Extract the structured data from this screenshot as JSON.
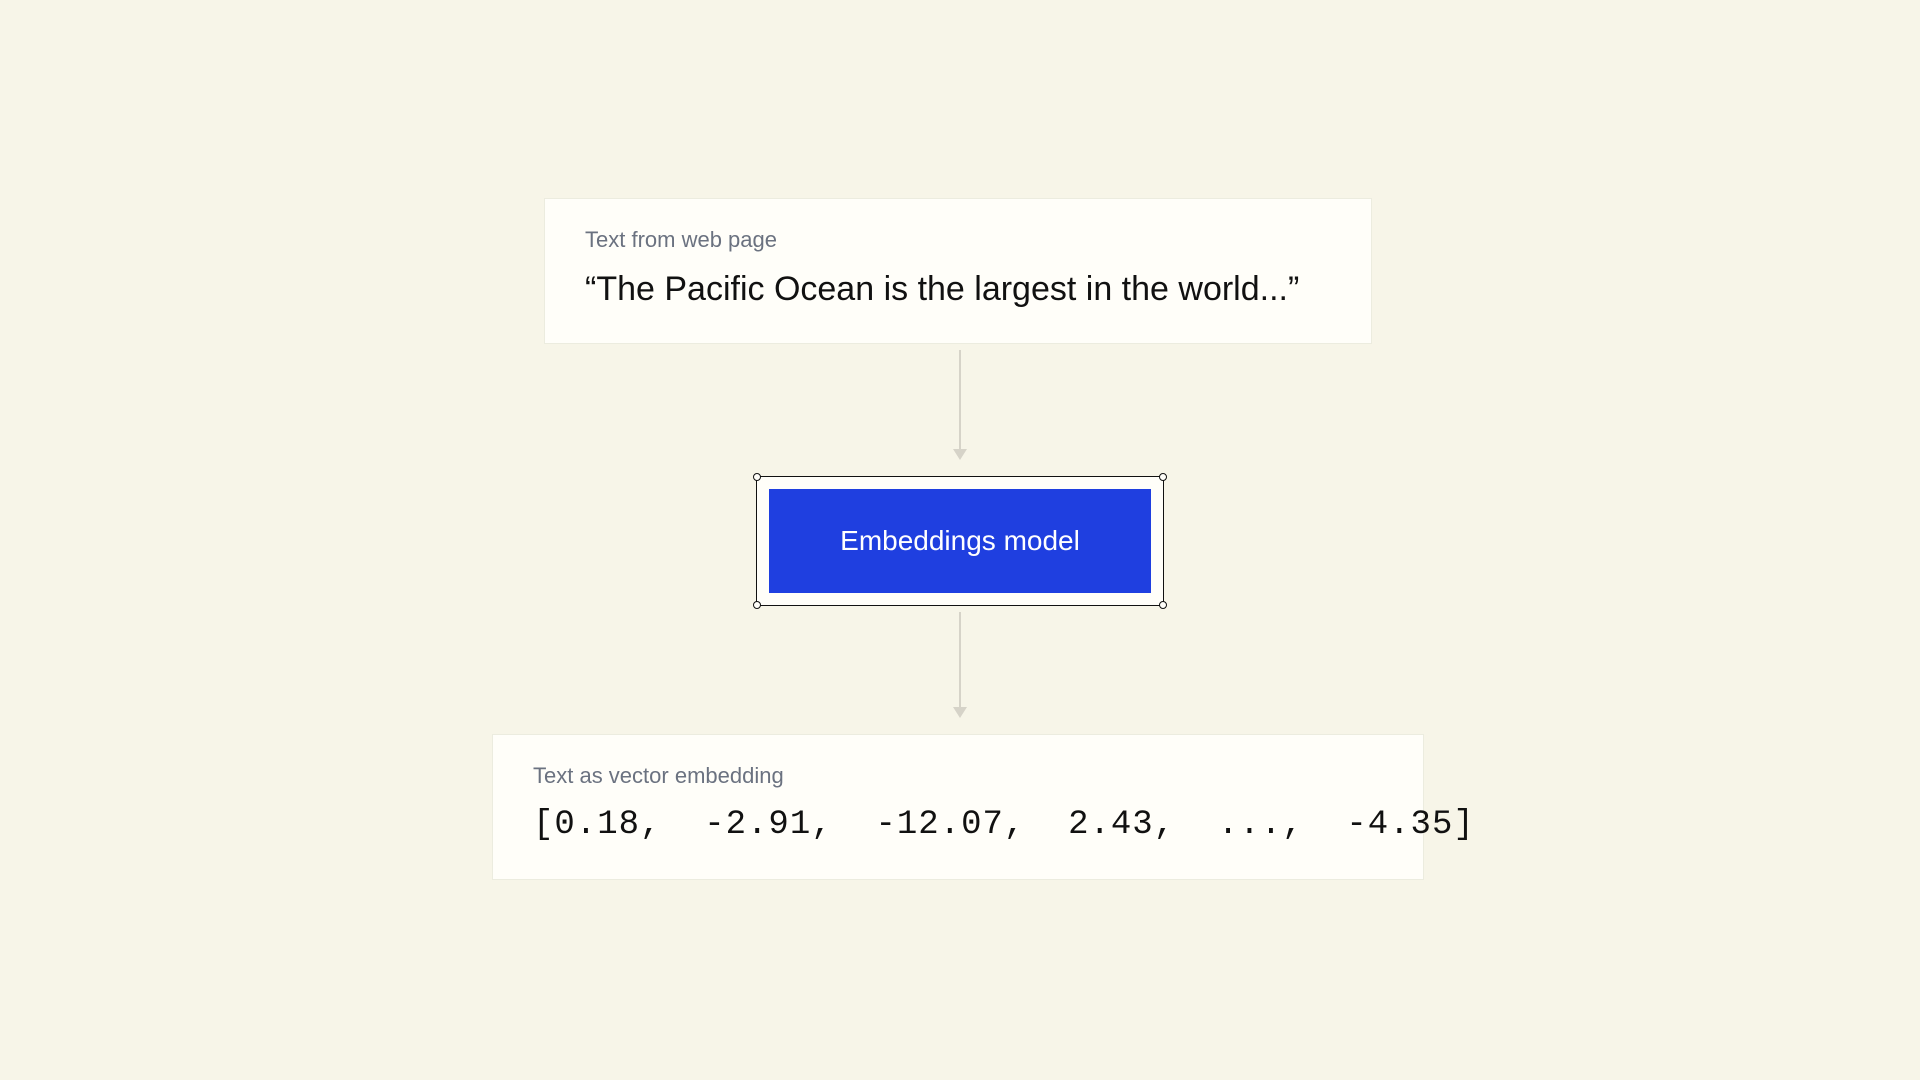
{
  "input": {
    "label": "Text from web page",
    "text": "“The Pacific Ocean is the largest in the world...”"
  },
  "model": {
    "label": "Embeddings model"
  },
  "output": {
    "label": "Text as vector embedding",
    "vector_display": "[0.18,  -2.91,  -12.07,  2.43,  ...,  -4.35]",
    "values": [
      0.18,
      -2.91,
      -12.07,
      2.43,
      -4.35
    ],
    "truncated": true
  },
  "colors": {
    "background": "#f7f5e8",
    "card": "#fffef9",
    "accent": "#1f3fe0",
    "muted": "#6b7280",
    "arrow": "#d6d3c8"
  }
}
